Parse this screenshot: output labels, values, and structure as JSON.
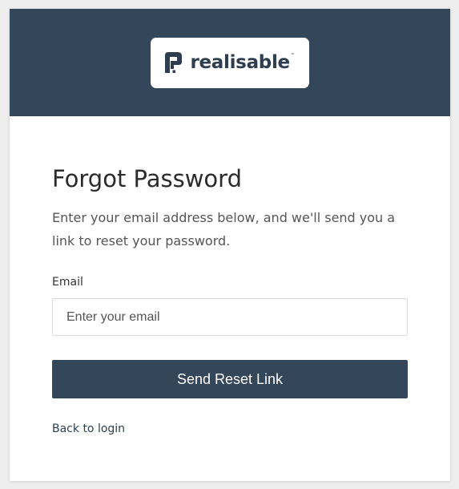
{
  "brand": {
    "name": "realisable",
    "trademark": "™",
    "icon": "realisable-logo-mark"
  },
  "form": {
    "title": "Forgot Password",
    "description": "Enter your email address below, and we'll send you a link to reset your password.",
    "email_label": "Email",
    "email_value": "",
    "email_placeholder": "Enter your email",
    "submit_label": "Send Reset Link",
    "back_link": "Back to login"
  },
  "colors": {
    "header_bg": "#344659",
    "logo_navy": "#2e3d4f",
    "button_bg": "#344659",
    "title_text": "#2b2b2b",
    "body_text": "#555555",
    "label_text": "#333333",
    "link_text": "#2e3d4f"
  }
}
